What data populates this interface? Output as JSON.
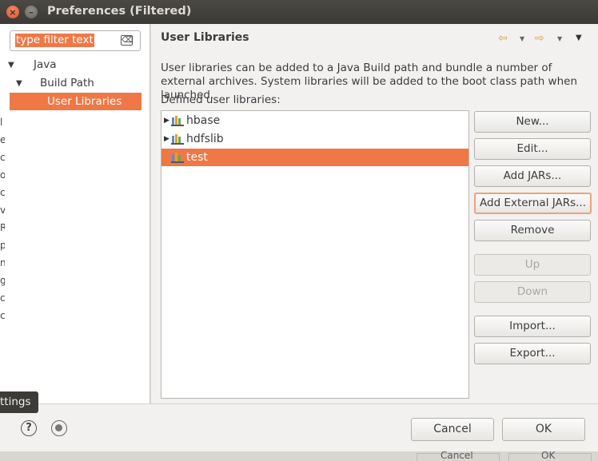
{
  "window": {
    "title": "Preferences (Filtered)"
  },
  "filter": {
    "text": "type filter text"
  },
  "tree": {
    "items": [
      {
        "label": "Java"
      },
      {
        "label": "Build Path"
      },
      {
        "label": "User Libraries"
      }
    ],
    "side_fragments": [
      "l",
      "e",
      "c",
      "o",
      "c",
      "v",
      "R",
      "p",
      "n",
      "g",
      "c",
      "c"
    ]
  },
  "page": {
    "title": "User Libraries",
    "description": "User libraries can be added to a Java Build path and bundle a number of external archives. System libraries will be added to the boot class path when launched.",
    "defined_label": "Defined user libraries:"
  },
  "libraries": [
    {
      "name": "hbase",
      "expandable": true,
      "selected": false
    },
    {
      "name": "hdfslib",
      "expandable": true,
      "selected": false
    },
    {
      "name": "test",
      "expandable": false,
      "selected": true
    }
  ],
  "buttons": {
    "new": "New...",
    "edit": "Edit...",
    "add_jars": "Add JARs...",
    "add_external_jars": "Add External JARs...",
    "remove": "Remove",
    "up": "Up",
    "down": "Down",
    "import": "Import...",
    "export": "Export..."
  },
  "footer": {
    "tooltip": "ttings",
    "cancel": "Cancel",
    "ok": "OK"
  },
  "background": {
    "cancel": "Cancel",
    "ok": "OK"
  },
  "colors": {
    "selection": "#f07746",
    "titlebar": "#3b3a36",
    "close": "#e0532c"
  }
}
